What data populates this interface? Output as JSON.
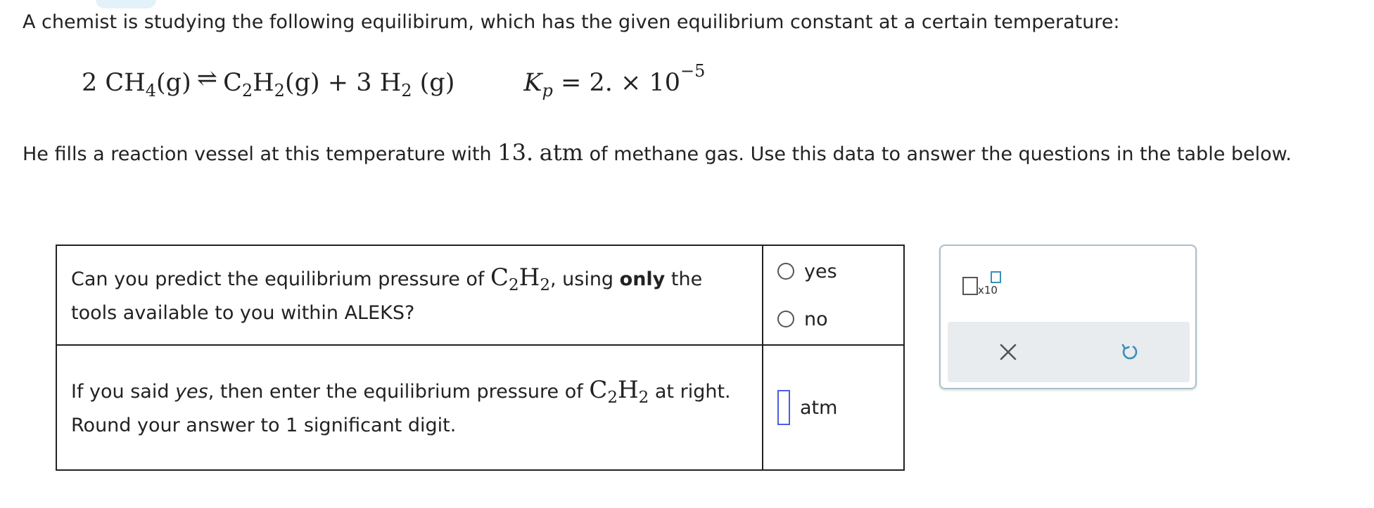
{
  "intro_text": "A chemist is studying the following equilibirum, which has the given equilibrium constant at a certain temperature:",
  "equation": {
    "reactant_coef": "2",
    "reactant_formula": "CH",
    "reactant_sub": "4",
    "reactant_state": "(g)",
    "arrow": "⇌",
    "product1_c": "C",
    "product1_c_sub": "2",
    "product1_h": "H",
    "product1_h_sub": "2",
    "product1_state": "(g)",
    "plus": "+",
    "product2_coef": "3",
    "product2_formula": "H",
    "product2_sub": "2",
    "product2_state": "(g)",
    "k_symbol": "K",
    "k_sub": "p",
    "k_value": "= 2. × 10",
    "k_exponent": "−5"
  },
  "fills_text": {
    "before": "He fills a reaction vessel at this temperature with ",
    "amount": "13.",
    "unit": "atm",
    "after": " of methane gas. Use this data to answer the questions in the table below."
  },
  "table": {
    "q1": {
      "part1": "Can you predict the equilibrium pressure of ",
      "species_c": "C",
      "species_c_sub": "2",
      "species_h": "H",
      "species_h_sub": "2",
      "part2": ", using ",
      "bold": "only",
      "part3": " the tools available to you within ALEKS?"
    },
    "options": [
      "yes",
      "no"
    ],
    "q2": {
      "part1": "If you said ",
      "italic": "yes",
      "part2": ", then enter the equilibrium pressure of ",
      "species_c": "C",
      "species_c_sub": "2",
      "species_h": "H",
      "species_h_sub": "2",
      "part3": " at right. Round your answer to 1 significant digit."
    },
    "answer_unit": "atm"
  },
  "tool_panel": {
    "sci_label": "x10",
    "icons": [
      "scientific-notation-icon",
      "clear-icon",
      "undo-icon"
    ]
  },
  "colors": {
    "accent_blue": "#4a5fe0",
    "panel_border": "#a9bfcd",
    "tool_bar_bg": "#e8ecef",
    "icon_blue": "#3a8fb8",
    "tab_bg": "#e3f1f9"
  }
}
